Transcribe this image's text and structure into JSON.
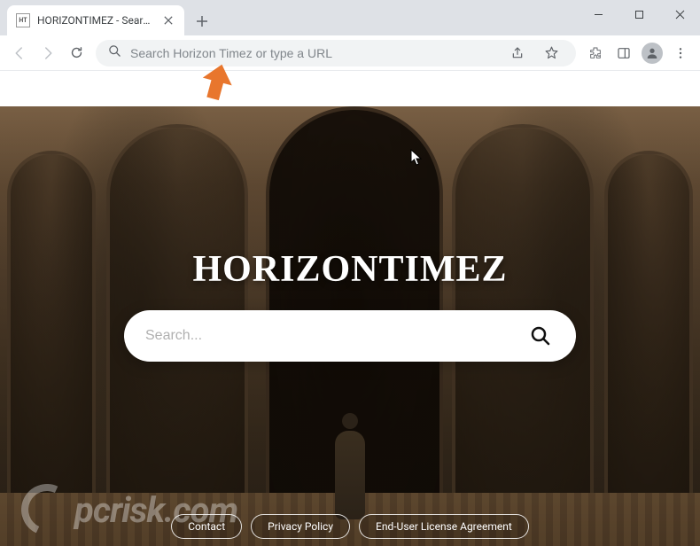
{
  "window": {
    "tab_title": "HORIZONTIMEZ - Search With U...",
    "tab_favicon_text": "HT"
  },
  "toolbar": {
    "address_placeholder": "Search Horizon Timez or type a URL"
  },
  "hero": {
    "brand": "HORIZONTIMEZ",
    "search_placeholder": "Search..."
  },
  "footer": {
    "links": [
      "Contact",
      "Privacy Policy",
      "End-User License Agreement"
    ]
  },
  "watermark": {
    "text": "pcrisk.com"
  }
}
